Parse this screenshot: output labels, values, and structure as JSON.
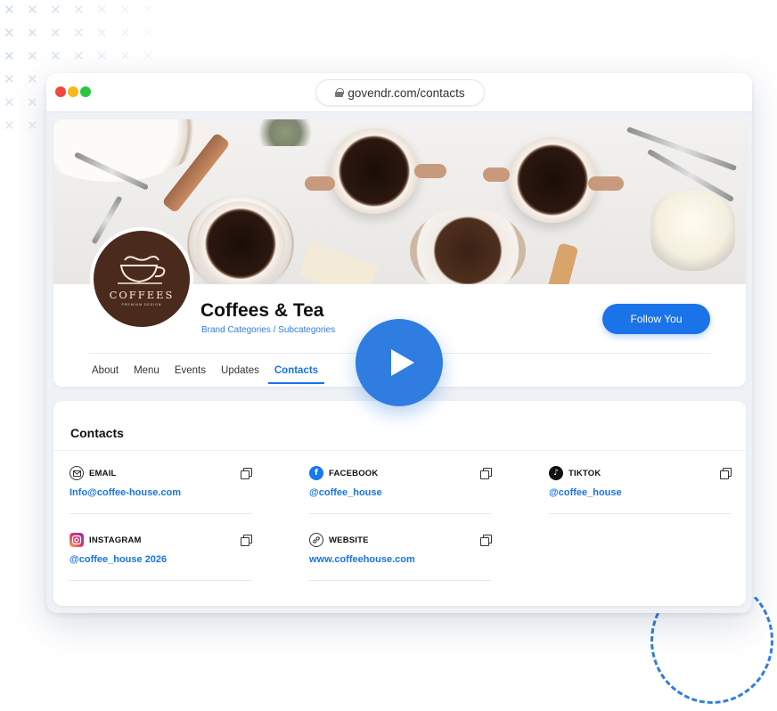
{
  "browser": {
    "url": "govendr.com/contacts"
  },
  "profile": {
    "logo": {
      "name": "COFFEES",
      "tagline": "PREMIUM DESIGN"
    },
    "brand_name": "Coffees & Tea",
    "categories": "Brand Categories / Subcategories",
    "follow_label": "Follow You",
    "tabs": [
      {
        "label": "About",
        "active": false
      },
      {
        "label": "Menu",
        "active": false
      },
      {
        "label": "Events",
        "active": false
      },
      {
        "label": "Updates",
        "active": false
      },
      {
        "label": "Contacts",
        "active": true
      }
    ]
  },
  "contacts": {
    "title": "Contacts",
    "items": [
      {
        "label": "EMAIL",
        "value": "Info@coffee-house.com",
        "icon": "email-icon"
      },
      {
        "label": "FACEBOOK",
        "value": "@coffee_house",
        "icon": "facebook-icon"
      },
      {
        "label": "TIKTOK",
        "value": "@coffee_house",
        "icon": "tiktok-icon"
      },
      {
        "label": "INSTAGRAM",
        "value": "@coffee_house 2026",
        "icon": "instagram-icon"
      },
      {
        "label": "WEBSITE",
        "value": "www.coffeehouse.com",
        "icon": "website-icon"
      }
    ]
  },
  "colors": {
    "accent": "#1a73e8",
    "play_button": "#2f7de1",
    "logo_background": "#4a2a1c"
  }
}
